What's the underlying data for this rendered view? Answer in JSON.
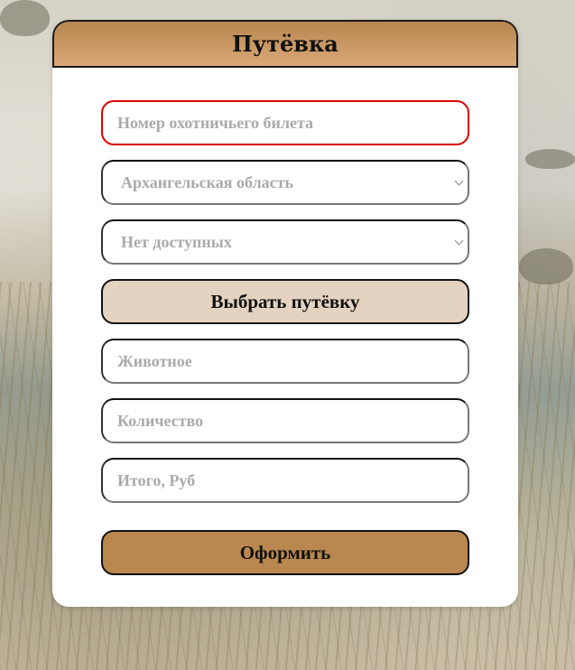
{
  "form": {
    "title": "Путёвка",
    "ticket_placeholder": "Номер охотничьего билета",
    "region_select": "Архангельская область",
    "voucher_select": "Нет доступных",
    "choose_button": "Выбрать путёвку",
    "animal_placeholder": "Животное",
    "quantity_placeholder": "Количество",
    "total_placeholder": "Итого, Руб",
    "submit_button": "Оформить"
  },
  "colors": {
    "header": "#c49462",
    "choose_button": "#e5d3c1",
    "submit_button": "#b9874f",
    "error_border": "#e00000"
  }
}
